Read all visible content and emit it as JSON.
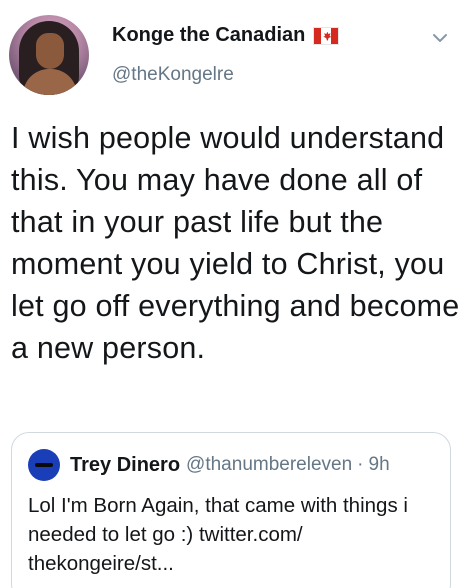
{
  "author": {
    "name": "Konge the Canadian",
    "handle": "@theKongelre",
    "flag_icon": "canada-flag-icon"
  },
  "tweet": {
    "text": "I wish people would understand this. You may have done all of that in your past life but the moment you yield to Christ, you let go off everything and become a new person."
  },
  "quoted_tweet": {
    "name": "Trey Dinero",
    "handle": "@thanumbereleven",
    "separator": "·",
    "time": "9h",
    "text": "Lol I'm Born Again, that came with things i needed to let go :) twitter.com/ thekongeire/st..."
  },
  "colors": {
    "primary_text": "#14171a",
    "secondary_text": "#657786",
    "border": "#cfd9de",
    "flag_red": "#d52b1e"
  }
}
